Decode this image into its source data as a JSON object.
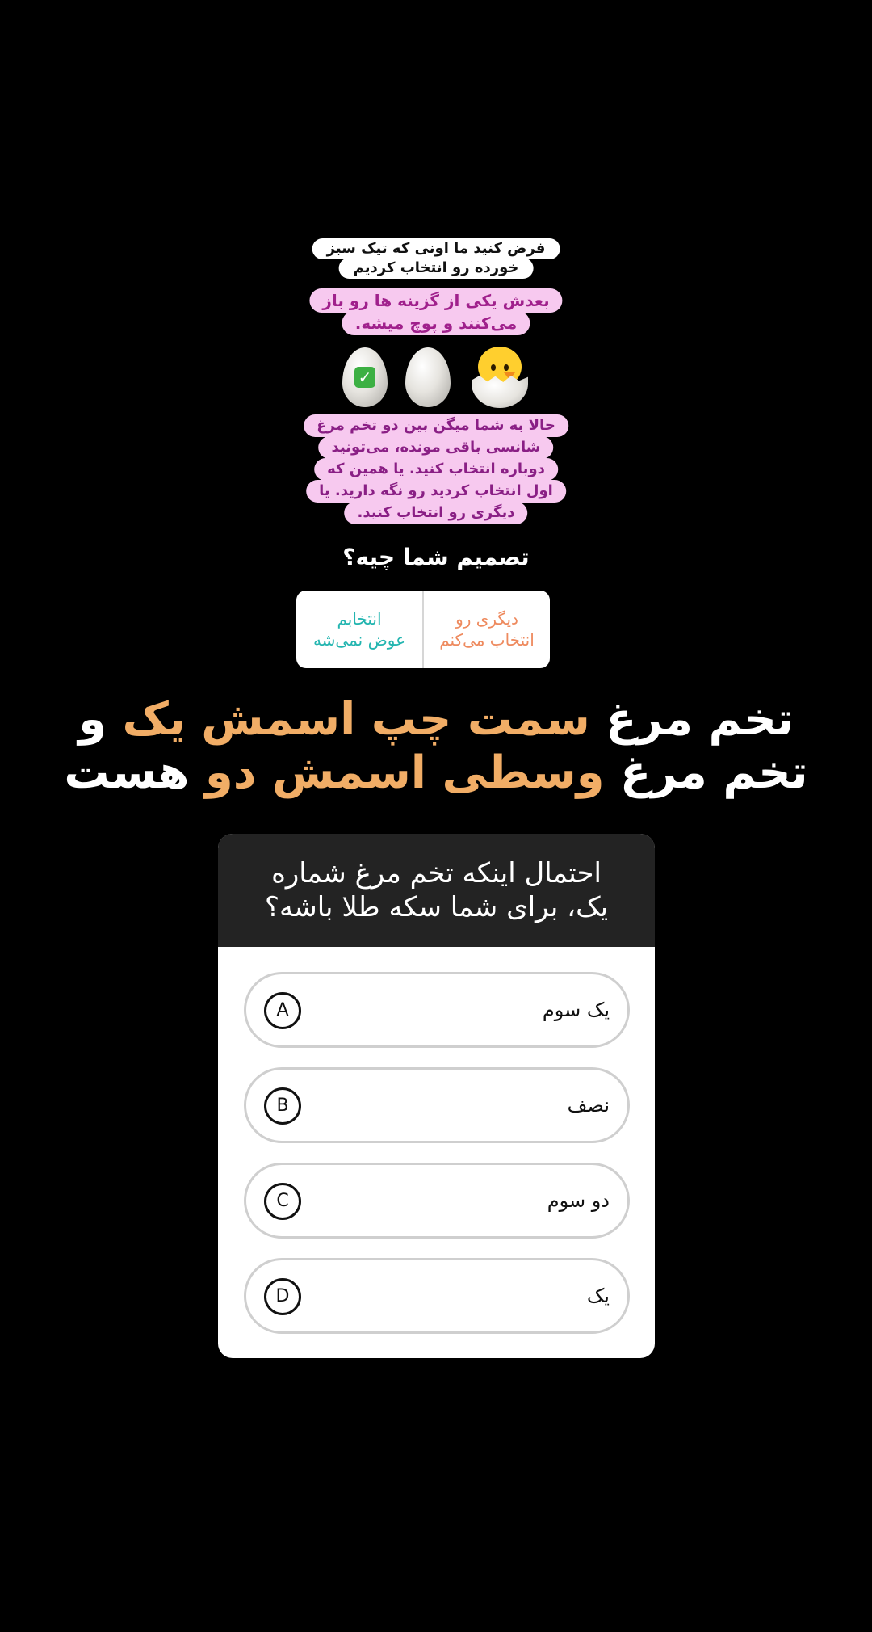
{
  "story": {
    "intro_bubble": [
      "فرض کنید ما اونی که تیک سبز",
      "خورده رو انتخاب کردیم"
    ],
    "reveal_bubble": [
      "بعدش یکی از گزینه ها رو باز",
      "می‌کنند و پوچ میشه."
    ],
    "offer_bubble": [
      "حالا به شما میگن بین دو تخم مرغ",
      "شانسی باقی مونده، می‌تونید",
      "دوباره انتخاب کنید. یا همین که",
      "اول انتخاب کردید رو نگه دارید. یا",
      "دیگری رو انتخاب کنید."
    ],
    "eggs": [
      "egg-checked",
      "egg-plain",
      "hatching-chick"
    ],
    "question": "تصمیم شما چیه؟"
  },
  "poll": {
    "option_keep": [
      "انتخابم",
      "عوض نمی‌شه"
    ],
    "option_switch": [
      "دیگری رو",
      "انتخاب می‌کنم"
    ],
    "colors": {
      "keep": "#23b5b0",
      "switch": "#ee8a5e"
    }
  },
  "headline": {
    "line1": [
      {
        "text": "تخم مرغ ",
        "color": "white"
      },
      {
        "text": "سمت چپ اسمش یک",
        "color": "orange"
      },
      {
        "text": " و",
        "color": "white"
      }
    ],
    "line2": [
      {
        "text": "تخم مرغ ",
        "color": "white"
      },
      {
        "text": "وسطی اسمش دو",
        "color": "orange"
      },
      {
        "text": " هست",
        "color": "white"
      }
    ],
    "accent_color": "#f1ad66"
  },
  "quiz": {
    "title": [
      "احتمال اینکه تخم مرغ شماره",
      "یک، برای شما سکه طلا باشه؟"
    ],
    "answers": [
      {
        "letter": "A",
        "text": "یک سوم"
      },
      {
        "letter": "B",
        "text": "نصف"
      },
      {
        "letter": "C",
        "text": "دو سوم"
      },
      {
        "letter": "D",
        "text": "یک"
      }
    ]
  }
}
